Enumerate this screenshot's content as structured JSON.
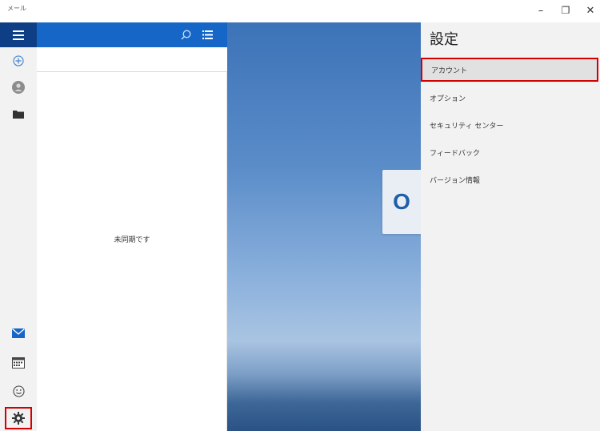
{
  "window": {
    "title": "メール",
    "minimize_glyph": "–",
    "maximize_glyph": "❐",
    "close_glyph": "✕"
  },
  "message_list": {
    "status": "未同期です"
  },
  "settings": {
    "title": "設定",
    "items": [
      {
        "label": "アカウント"
      },
      {
        "label": "オプション"
      },
      {
        "label": "セキュリティ センター"
      },
      {
        "label": "フィードバック"
      },
      {
        "label": "バージョン情報"
      }
    ]
  },
  "tile": {
    "letter": "O"
  },
  "icons": [
    "hamburger-icon",
    "search-icon",
    "filter-list-icon",
    "plus-icon",
    "avatar-icon",
    "folder-icon",
    "mail-icon",
    "calendar-icon",
    "smiley-icon",
    "gear-icon"
  ],
  "colors": {
    "accent_dark": "#0e3f86",
    "accent": "#1566c6",
    "highlight_border": "#d40000",
    "panel_bg": "#f2f2f2"
  }
}
